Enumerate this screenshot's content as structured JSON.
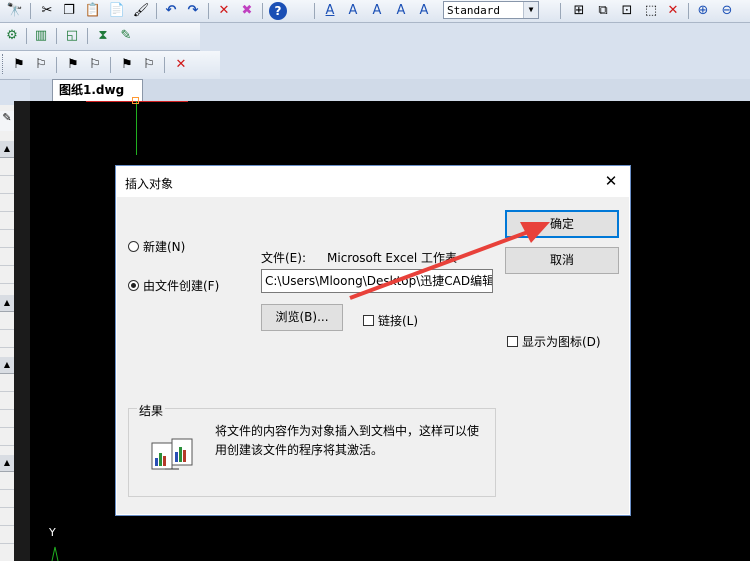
{
  "toolbar": {
    "style_combo_value": "Standard",
    "row1_icons": [
      "binoculars-icon",
      "cut-icon",
      "copy-icon",
      "paste-icon",
      "paste-special-icon",
      "match-properties-icon",
      "undo-icon",
      "redo-icon",
      "delete-icon",
      "erase-icon",
      "help-icon",
      "text-style-icon",
      "text-icon",
      "text-edit-icon",
      "text-find-icon",
      "text-replace-icon",
      "layout-icon",
      "group-icon",
      "ungroup-icon",
      "select-icon",
      "close-icon",
      "zoom-in-icon",
      "zoom-out-icon"
    ],
    "row2_icons": [
      "circle-snap-icon",
      "grid-icon",
      "layer-icon",
      "hourglass-icon",
      "pen-icon"
    ],
    "row3_icons": [
      "tool1-icon",
      "tool2-icon",
      "tool3-icon",
      "tool4-icon",
      "tool5-icon",
      "tool6-icon",
      "delete-red-icon"
    ]
  },
  "tabs": {
    "drawing_tab": "图纸1.dwg"
  },
  "canvas": {
    "ucs_y_label": "Y"
  },
  "dialog": {
    "title": "插入对象",
    "close_symbol": "X",
    "radio_new": "新建(N)",
    "radio_from_file": "由文件创建(F)",
    "file_label": "文件(E):",
    "file_type": "Microsoft Excel 工作表",
    "file_path": "C:\\Users\\Mloong\\Desktop\\迅捷CAD编辑",
    "browse_button": "浏览(B)...",
    "link_checkbox": "链接(L)",
    "ok_button": "确定",
    "cancel_button": "取消",
    "display_as_icon": "显示为图标(D)",
    "result_label": "结果",
    "result_text": "将文件的内容作为对象插入到文档中，这样可以使用创建该文件的程序将其激活。"
  },
  "colors": {
    "canvas_bg": "#000000",
    "annotation_arrow": "#e8413a",
    "dialog_accent": "#0078d7"
  }
}
